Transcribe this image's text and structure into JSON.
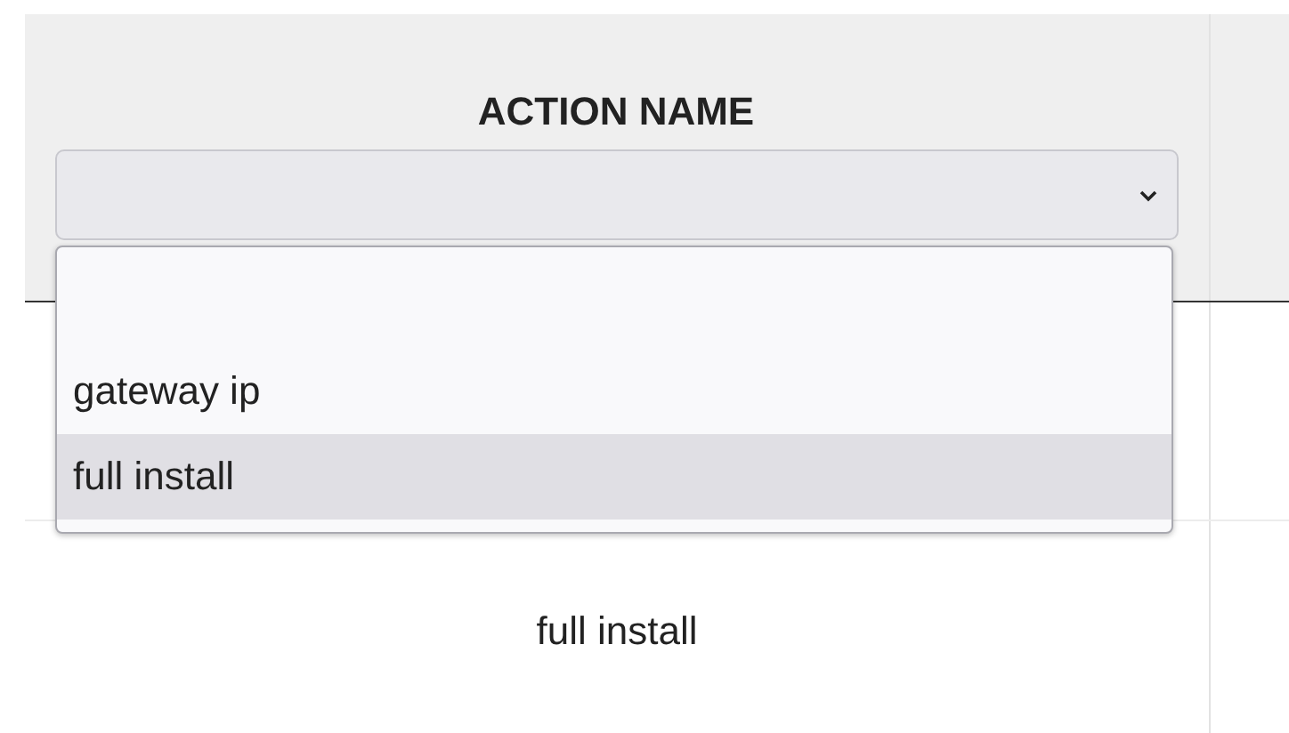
{
  "table": {
    "columns": [
      {
        "label": "ACTION NAME",
        "filter": {
          "expanded": true,
          "options": [
            {
              "selected": false
            },
            {
              "label": "gateway ip",
              "selected": false
            },
            {
              "label": "full install",
              "selected": true
            }
          ]
        }
      }
    ],
    "rows": [
      {
        "cells": [
          "full install"
        ]
      }
    ]
  }
}
